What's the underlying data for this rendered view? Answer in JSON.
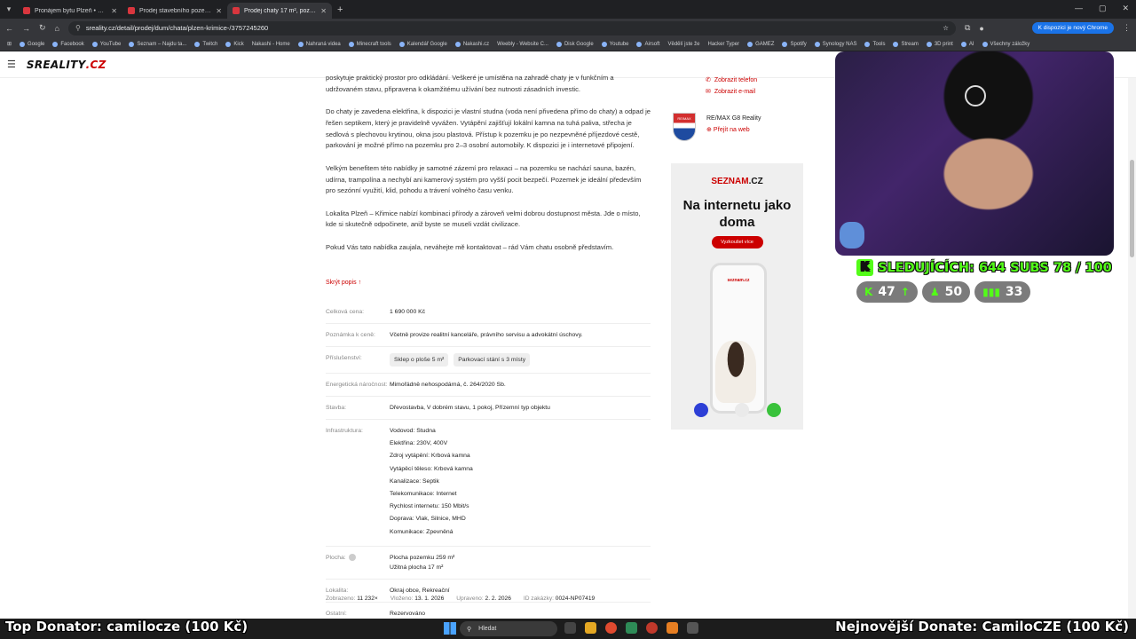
{
  "browser": {
    "tabs": [
      {
        "title": "Pronájem bytu Plzeň • Sreality"
      },
      {
        "title": "Prodej stavebního pozemku 43..."
      },
      {
        "title": "Prodej chaty 17 m², pozemek 2..."
      }
    ],
    "url": "sreality.cz/detail/prodej/dum/chata/plzen-krimice-/3757245260",
    "chrome_button": "K dispozici je nový Chrome",
    "bookmarks": [
      "Google",
      "Facebook",
      "YouTube",
      "Seznam – Najdu ta...",
      "Twitch",
      "Kick",
      "Nakashi - Home",
      "Nahraná videa",
      "Minecraft tools",
      "Kalendář Google",
      "Nakashi.cz",
      "Weebly - Website C...",
      "Disk Google",
      "Youtube",
      "Airsoft",
      "Vědělí jste že",
      "Hacker Typer",
      "GAMEZ",
      "Spotify",
      "Synology NAS",
      "Tools",
      "Stream",
      "3D print",
      "AI",
      "Všechny záložky"
    ]
  },
  "site": {
    "logo_main": "SREALITY",
    "logo_tld": ".CZ"
  },
  "description": {
    "paragraphs": [
      "poskytuje praktický prostor pro odkládání. Veškeré je umístěna na zahradě chaty je v funkčním a udržovaném stavu, připravena k okamžitému užívání bez nutnosti zásadních investic.",
      "Do chaty je zavedena elektřina, k dispozici je vlastní studna (voda není přivedena přímo do chaty) a odpad je řešen septikem, který je pravidelně vyvážen. Vytápění zajišťují lokální kamna na tuhá paliva, střecha je sedlová s plechovou krytinou, okna jsou plastová. Přístup k pozemku je po nezpevněné příjezdové cestě, parkování je možné přímo na pozemku pro 2–3 osobní automobily. K dispozici je i internetové připojení.",
      "Velkým benefitem této nabídky je samotné zázemí pro relaxaci – na pozemku se nachází sauna, bazén, udírna, trampolína a nechybí ani kamerový systém pro vyšší pocit bezpečí. Pozemek je ideální především pro sezónní využití, klid, pohodu a trávení volného času venku.",
      "Lokalita Plzeň – Křimice nabízí kombinaci přírody a zároveň velmi dobrou dostupnost města. Jde o místo, kde si skutečně odpočinete, aniž byste se museli vzdát civilizace.",
      "Pokud Vás tato nabídka zaujala, neváhejte mě kontaktovat – rád Vám chatu osobně představím."
    ],
    "hide_link": "Skrýt popis ↑"
  },
  "details": {
    "price_label": "Celková cena:",
    "price_value": "1 690 000 Kč",
    "price_note_label": "Poznámka k ceně:",
    "price_note_value": "Včetně provize realitní kanceláře, právního servisu a advokátní úschovy.",
    "accessories_label": "Příslušenství:",
    "accessories": [
      "Sklep o ploše 5 m²",
      "Parkovací stání s 3 místy"
    ],
    "energy_label": "Energetická náročnost:",
    "energy_value": "Mimořádně nehospodárná, č. 264/2020 Sb.",
    "building_label": "Stavba:",
    "building_value": "Dřevostavba, V dobrém stavu, 1 pokoj, Přízemní typ objektu",
    "infra_label": "Infrastruktura:",
    "infra": [
      "Vodovod: Studna",
      "Elektřina: 230V, 400V",
      "Zdroj vytápění: Krbová kamna",
      "Vytápěcí těleso: Krbová kamna",
      "Kanalizace: Septik",
      "Telekomunikace: Internet",
      "Rychlost internetu: 150 Mbit/s",
      "Doprava: Vlak, Silnice, MHD",
      "Komunikace: Zpevněná"
    ],
    "area_label": "Plocha:",
    "area": [
      "Plocha pozemku 259 m²",
      "Užitná plocha 17 m²"
    ],
    "locality_label": "Lokalita:",
    "locality_value": "Okraj obce, Rekreační",
    "other_label": "Ostatní:",
    "other_value": "Rezervováno"
  },
  "meta": {
    "views_label": "Zobrazeno:",
    "views_value": "11 232×",
    "inserted_label": "Vloženo:",
    "inserted_value": "13. 1. 2026",
    "edited_label": "Upraveno:",
    "edited_value": "2. 2. 2026",
    "id_label": "ID zakázky:",
    "id_value": "0024-NP07419"
  },
  "sidebar": {
    "show_phone": "Zobrazit telefon",
    "show_email": "Zobrazit e-mail",
    "agency_name": "RE/MAX G8 Reality",
    "agency_web": "Přejít na web"
  },
  "ad": {
    "logo_a": "SEZNAM",
    "logo_b": ".CZ",
    "headline": "Na internetu jako doma",
    "button": "Vyzkoušet více",
    "phone_logo": "seznam.cz"
  },
  "stream": {
    "followers_line": "SLEDUJÍCÍCH: 644  SUBS 78 / 100",
    "kick_letter": "K",
    "pill_1": "47",
    "pill_2": "50",
    "pill_3": "33",
    "top_donator": "Top Donator: camilocze (100 Kč)",
    "latest_donate": "Nejnovější Donate: CamiloCZE (100 Kč)"
  },
  "taskbar": {
    "search_placeholder": "Hledat"
  },
  "colors": {
    "accent_red": "#cc0000",
    "kick_green": "#53fc18"
  }
}
